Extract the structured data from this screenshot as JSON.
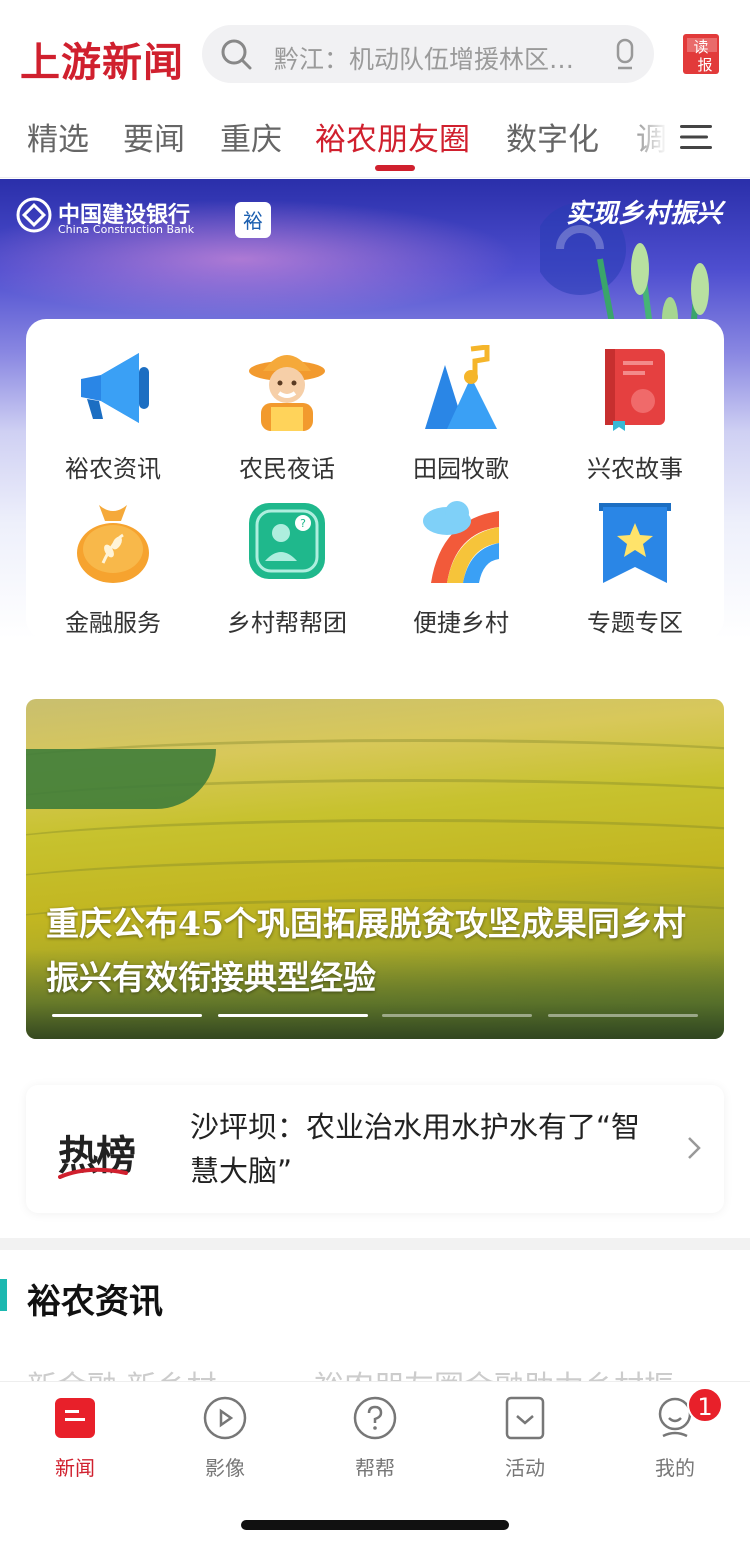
{
  "header": {
    "logo": "上游新闻",
    "search_placeholder": "黔江：机动队伍增援林区…",
    "read_paper_icon": "读报"
  },
  "tabs": [
    "精选",
    "要闻",
    "重庆",
    "裕农朋友圈",
    "数字化",
    "调"
  ],
  "active_tab": "裕农朋友圈",
  "banner": {
    "bank_name_cn": "中国建设银行",
    "bank_name_en": "China Construction Bank",
    "slogan": "实现乡村振兴"
  },
  "grid": [
    {
      "label": "裕农资讯",
      "icon": "megaphone-icon"
    },
    {
      "label": "农民夜话",
      "icon": "farmer-icon"
    },
    {
      "label": "田园牧歌",
      "icon": "music-mountain-icon"
    },
    {
      "label": "兴农故事",
      "icon": "book-icon"
    },
    {
      "label": "金融服务",
      "icon": "money-bag-icon"
    },
    {
      "label": "乡村帮帮团",
      "icon": "helper-group-icon"
    },
    {
      "label": "便捷乡村",
      "icon": "rainbow-icon"
    },
    {
      "label": "专题专区",
      "icon": "star-bookmark-icon"
    }
  ],
  "hero": {
    "title": "重庆公布45个巩固拓展脱贫攻坚成果同乡村振兴有效衔接典型经验",
    "slide_count": 4,
    "active_slide": 2
  },
  "hot": {
    "badge": "热榜",
    "text": "沙坪坝：农业治水用水护水有了“智慧大脑”"
  },
  "section": {
    "title": "裕农资讯",
    "peek": [
      "新金融 新乡村",
      "裕农朋友圈金融助力乡村振"
    ]
  },
  "bottom_nav": [
    {
      "label": "新闻",
      "icon": "news-icon",
      "active": true
    },
    {
      "label": "影像",
      "icon": "video-icon",
      "active": false
    },
    {
      "label": "帮帮",
      "icon": "help-icon",
      "active": false
    },
    {
      "label": "活动",
      "icon": "activity-icon",
      "active": false
    },
    {
      "label": "我的",
      "icon": "profile-icon",
      "active": false
    }
  ],
  "notification_badge": "1",
  "colors": {
    "brand_red": "#d0202e",
    "accent_teal": "#1cb8b0"
  }
}
